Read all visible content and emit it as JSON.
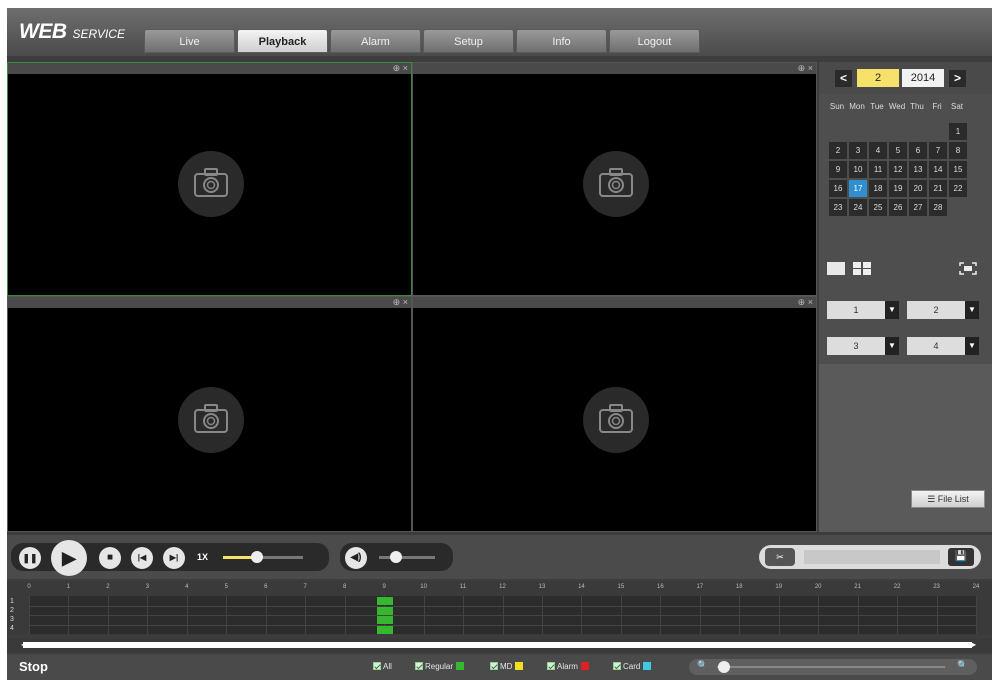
{
  "app": {
    "logo_main": "WEB",
    "logo_sub": "SERVICE"
  },
  "tabs": [
    {
      "label": "Live",
      "active": false
    },
    {
      "label": "Playback",
      "active": true
    },
    {
      "label": "Alarm",
      "active": false
    },
    {
      "label": "Setup",
      "active": false
    },
    {
      "label": "Info",
      "active": false
    },
    {
      "label": "Logout",
      "active": false
    }
  ],
  "panes": [
    {
      "zoom_icon": "zoom-in-icon",
      "close": "×"
    },
    {
      "zoom_icon": "zoom-in-icon",
      "close": "×"
    },
    {
      "zoom_icon": "zoom-in-icon",
      "close": "×"
    },
    {
      "zoom_icon": "zoom-in-icon",
      "close": "×"
    }
  ],
  "calendar": {
    "month": "2",
    "year": "2014",
    "prev": "<",
    "next": ">",
    "weekdays": [
      "Sun",
      "Mon",
      "Tue",
      "Wed",
      "Thu",
      "Fri",
      "Sat"
    ],
    "first_weekday": 6,
    "days_in_month": 28,
    "selected_day": 17
  },
  "channels": [
    {
      "value": "1"
    },
    {
      "value": "2"
    },
    {
      "value": "3"
    },
    {
      "value": "4"
    }
  ],
  "file_list_label": "File List",
  "playback": {
    "speed": "1X",
    "progress_fraction": 0.42,
    "volume_fraction": 0.3
  },
  "timeline": {
    "hours": [
      "0",
      "1",
      "2",
      "3",
      "4",
      "5",
      "6",
      "7",
      "8",
      "9",
      "10",
      "11",
      "12",
      "13",
      "14",
      "15",
      "16",
      "17",
      "18",
      "19",
      "20",
      "21",
      "22",
      "23",
      "24"
    ],
    "rows": [
      "1",
      "2",
      "3",
      "4"
    ],
    "record_hour": 9,
    "record_color": "#35b82e"
  },
  "status": {
    "state": "Stop"
  },
  "filters": [
    {
      "label": "All",
      "color": ""
    },
    {
      "label": "Regular",
      "color": "#35b82e"
    },
    {
      "label": "MD",
      "color": "#f0e020"
    },
    {
      "label": "Alarm",
      "color": "#e02020"
    },
    {
      "label": "Card",
      "color": "#40c8e0"
    }
  ],
  "zoom_fraction": 0.03
}
